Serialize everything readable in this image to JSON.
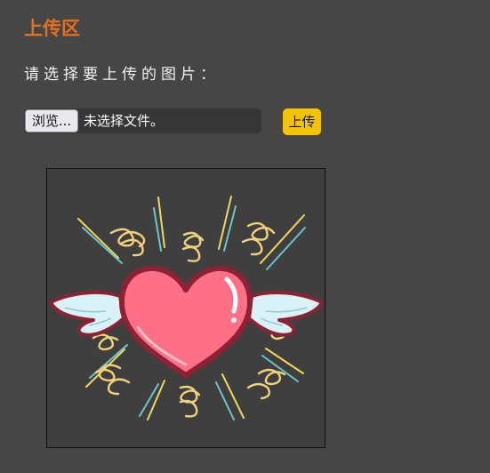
{
  "page": {
    "title": "上传区",
    "prompt": "请选择要上传的图片：",
    "colors": {
      "background": "#464646",
      "title": "#e6711a",
      "upload_button": "#f5c400",
      "heart": "#ff6f86",
      "heart_outline": "#8e2235",
      "wings": "#d9f2f7",
      "swirls": "#f3d27a"
    }
  },
  "file_input": {
    "browse_label": "浏览...",
    "status_text": "未选择文件。"
  },
  "upload": {
    "label": "上传"
  },
  "preview": {
    "icon": "winged-heart-icon"
  }
}
